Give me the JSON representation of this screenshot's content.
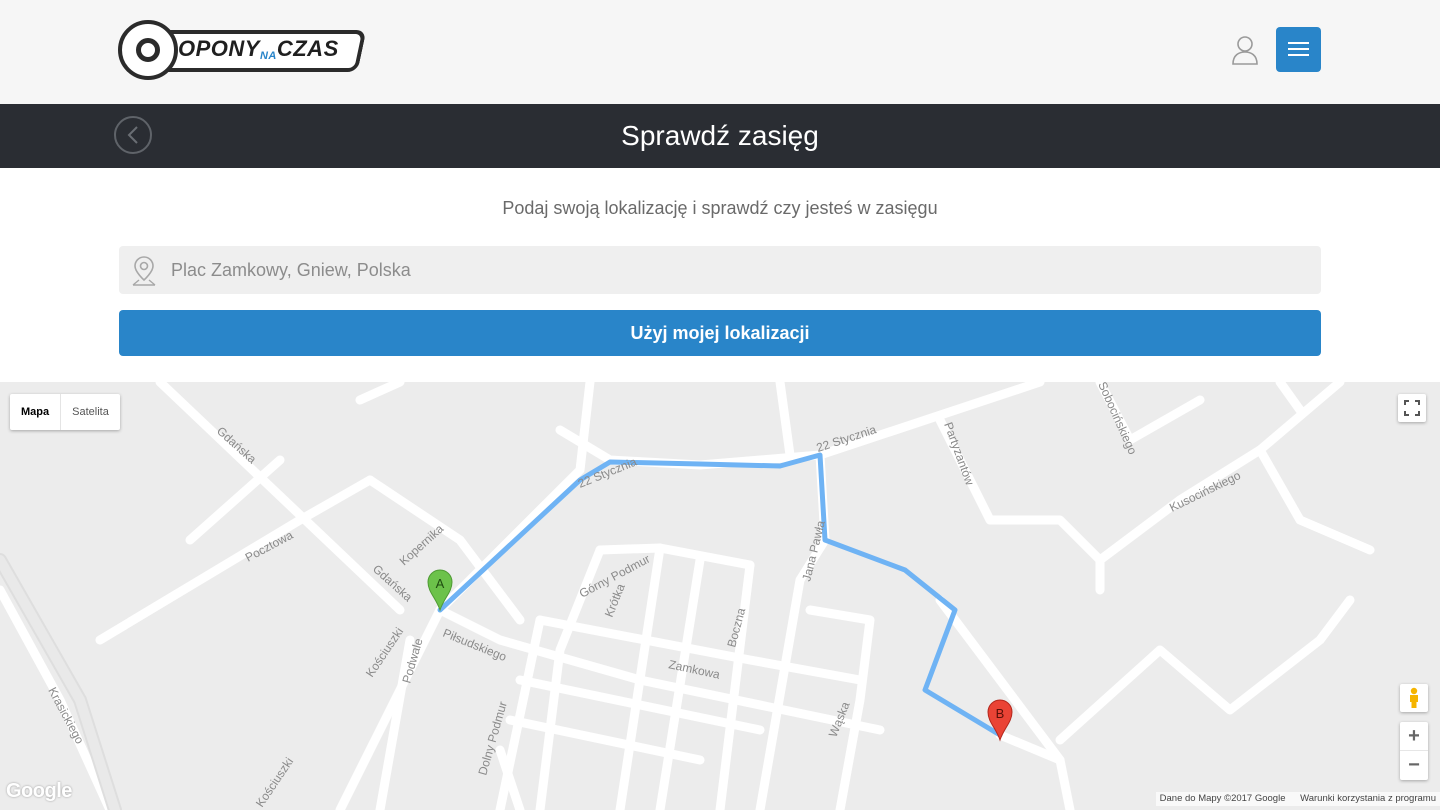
{
  "header": {
    "logo": {
      "text_main_1": "OPONY",
      "text_small": "NA",
      "text_main_2": "CZAS"
    },
    "icons": {
      "user": "user-icon",
      "menu": "hamburger-menu-icon"
    }
  },
  "title_bar": {
    "title": "Sprawdź zasięg",
    "back_icon": "chevron-left-icon"
  },
  "content": {
    "subtitle": "Podaj swoją lokalizację i sprawdź czy jesteś w zasięgu",
    "search": {
      "placeholder": "Plac Zamkowy, Gniew, Polska",
      "icon": "map-pin-icon"
    },
    "use_location_button": "Użyj mojej lokalizacji"
  },
  "map": {
    "map_type": {
      "map": "Mapa",
      "satellite": "Satelita"
    },
    "marker_a": "A",
    "marker_b": "B",
    "streets": {
      "gdanska_1": "Gdańska",
      "gdanska_2": "Gdańska",
      "pocztowa": "Pocztowa",
      "kopernika": "Kopernika",
      "stycznia_1": "22 Stycznia",
      "stycznia_2": "22 Stycznia",
      "partyzantow": "Partyzantów",
      "sobocinskiego": "Sobocińskiego",
      "kusocinskiego": "Kusocińskiego",
      "gorny_podmur": "Górny Podmur",
      "krotka": "Krótka",
      "boczna": "Boczna",
      "jana_pawla": "Jana Pawła",
      "zamkowa": "Zamkowa",
      "koscuszki_1": "Kościuszki",
      "koscuszki_2": "Kościuszki",
      "podwale": "Podwale",
      "pilsudskiego": "Piłsudskiego",
      "dolny_podmur": "Dolny Podmur",
      "waska": "Wąska",
      "krasickiego": "Krasickiego"
    },
    "google_logo": "Google",
    "attribution": "Dane do Mapy ©2017 Google",
    "terms": "Warunki korzystania z programu",
    "controls": {
      "fullscreen": "fullscreen-icon",
      "pegman": "pegman-icon",
      "zoom_in": "+",
      "zoom_out": "−"
    },
    "colors": {
      "route": "#6fb3f4",
      "marker_a": "#6cc24a",
      "marker_b": "#ea4335",
      "road": "#ffffff",
      "background": "#ececec"
    }
  },
  "colors": {
    "accent": "#2985c9",
    "title_bar": "#2a2d33",
    "topbar": "#f6f6f6"
  }
}
